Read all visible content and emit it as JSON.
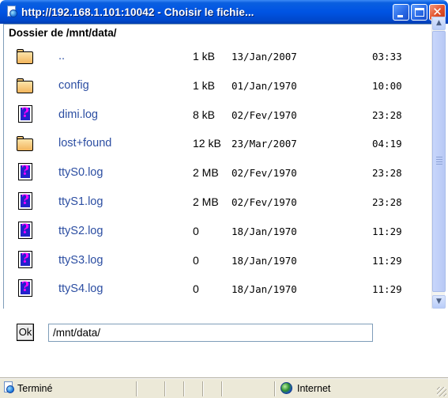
{
  "window": {
    "title": "http://192.168.1.101:10042 - Choisir le fichie...",
    "buttons": {
      "minimize": "minimize-icon",
      "maximize": "maximize-icon",
      "close": "close-icon"
    }
  },
  "browser": {
    "heading": "Dossier de /mnt/data/",
    "files": [
      {
        "icon": "folder-icon",
        "name": "..",
        "size": "1 kB",
        "date": "13/Jan/2007",
        "time": "03:33"
      },
      {
        "icon": "folder-icon",
        "name": "config",
        "size": "1 kB",
        "date": "01/Jan/1970",
        "time": "10:00"
      },
      {
        "icon": "unknown-file-icon",
        "name": "dimi.log",
        "size": "8 kB",
        "date": "02/Fev/1970",
        "time": "23:28"
      },
      {
        "icon": "folder-icon",
        "name": "lost+found",
        "size": "12 kB",
        "date": "23/Mar/2007",
        "time": "04:19"
      },
      {
        "icon": "unknown-file-icon",
        "name": "ttyS0.log",
        "size": "2 MB",
        "date": "02/Fev/1970",
        "time": "23:28"
      },
      {
        "icon": "unknown-file-icon",
        "name": "ttyS1.log",
        "size": "2 MB",
        "date": "02/Fev/1970",
        "time": "23:28"
      },
      {
        "icon": "unknown-file-icon",
        "name": "ttyS2.log",
        "size": "0",
        "date": "18/Jan/1970",
        "time": "11:29"
      },
      {
        "icon": "unknown-file-icon",
        "name": "ttyS3.log",
        "size": "0",
        "date": "18/Jan/1970",
        "time": "11:29"
      },
      {
        "icon": "unknown-file-icon",
        "name": "ttyS4.log",
        "size": "0",
        "date": "18/Jan/1970",
        "time": "11:29"
      }
    ]
  },
  "form": {
    "ok_label": "Ok",
    "path_value": "/mnt/data/"
  },
  "statusbar": {
    "status_text": "Terminé",
    "zone_text": "Internet"
  },
  "colors": {
    "titlebar": "#0054e3",
    "link": "#2c4ea2",
    "unknown_icon_fill": "#2222cc",
    "unknown_icon_mark": "#ff00ff",
    "folder_fill": "#f2b55c"
  }
}
